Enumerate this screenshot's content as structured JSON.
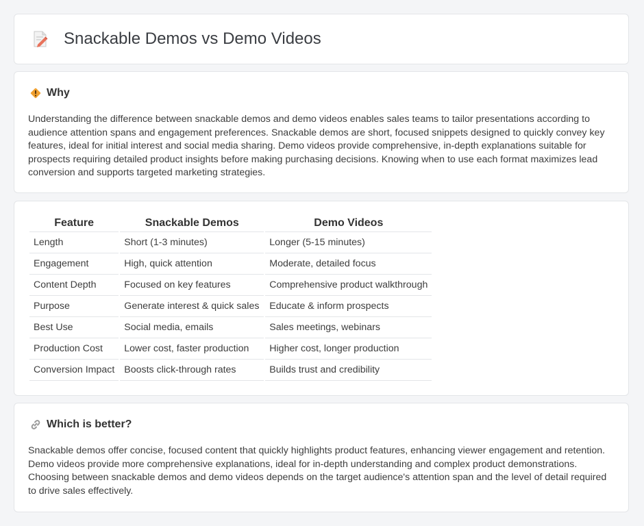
{
  "header": {
    "title": "Snackable Demos vs Demo Videos",
    "icon": "document-pencil-icon"
  },
  "why": {
    "title": "Why",
    "icon": "warning-sign-icon",
    "text": "Understanding the difference between snackable demos and demo videos enables sales teams to tailor presentations according to audience attention spans and engagement preferences. Snackable demos are short, focused snippets designed to quickly convey key features, ideal for initial interest and social media sharing. Demo videos provide comprehensive, in-depth explanations suitable for prospects requiring detailed product insights before making purchasing decisions. Knowing when to use each format maximizes lead conversion and supports targeted marketing strategies."
  },
  "table": {
    "headers": [
      "Feature",
      "Snackable Demos",
      "Demo Videos"
    ],
    "rows": [
      [
        "Length",
        "Short (1-3 minutes)",
        "Longer (5-15 minutes)"
      ],
      [
        "Engagement",
        "High, quick attention",
        "Moderate, detailed focus"
      ],
      [
        "Content Depth",
        "Focused on key features",
        "Comprehensive product walkthrough"
      ],
      [
        "Purpose",
        "Generate interest & quick sales",
        "Educate & inform prospects"
      ],
      [
        "Best Use",
        "Social media, emails",
        "Sales meetings, webinars"
      ],
      [
        "Production Cost",
        "Lower cost, faster production",
        "Higher cost, longer production"
      ],
      [
        "Conversion Impact",
        "Boosts click-through rates",
        "Builds trust and credibility"
      ]
    ]
  },
  "better": {
    "title": "Which is better?",
    "icon": "link-icon",
    "text": "Snackable demos offer concise, focused content that quickly highlights product features, enhancing viewer engagement and retention. Demo videos provide more comprehensive explanations, ideal for in-depth understanding and complex product demonstrations. Choosing between snackable demos and demo videos depends on the target audience's attention span and the level of detail required to drive sales effectively."
  },
  "colors": {
    "background": "#f4f5f7",
    "card": "#ffffff",
    "border": "#e3e5e8",
    "warning": "#f0a030"
  }
}
